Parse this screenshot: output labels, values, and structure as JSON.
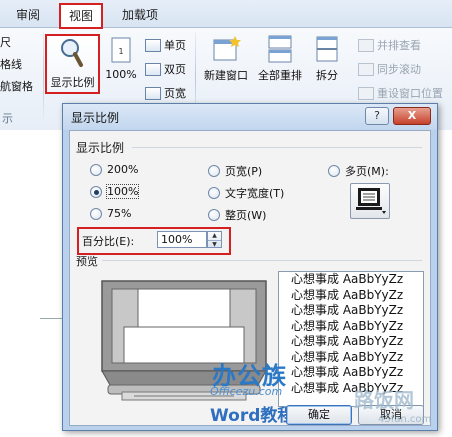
{
  "ribbon": {
    "tabs": [
      "审阅",
      "视图",
      "加载项"
    ],
    "active_tab": "视图",
    "left_cut": [
      "尺",
      "格线",
      "航窗格"
    ],
    "left_group_label": "示",
    "zoom_button": "显示比例",
    "hundred_button": "100%",
    "page_buttons": [
      "单页",
      "双页",
      "页宽"
    ],
    "window_buttons": [
      "新建窗口",
      "全部重排",
      "拆分"
    ],
    "right_buttons": [
      "并排查看",
      "同步滚动",
      "重设窗口位置"
    ]
  },
  "dialog": {
    "title": "显示比例",
    "help": "?",
    "close": "X",
    "zoom_section": "显示比例",
    "radios": {
      "z200": "200%",
      "z100": "100%",
      "z75": "75%",
      "page_width": "页宽(P)",
      "text_width": "文字宽度(T)",
      "whole_page": "整页(W)",
      "many_pages": "多页(M):"
    },
    "selected": "100%",
    "percent_label": "百分比(E):",
    "percent_value": "100%",
    "preview_label": "预览",
    "sample_lines": [
      "心想事成 AaBbYyZz",
      "心想事成 AaBbYyZz",
      "心想事成 AaBbYyZz",
      "心想事成 AaBbYyZz",
      "心想事成 AaBbYyZz",
      "心想事成 AaBbYyZz",
      "心想事成 AaBbYyZz",
      "心想事成 AaBbYyZz"
    ],
    "ok": "确定",
    "cancel": "取消"
  },
  "watermark": {
    "brand": "办公族",
    "url": "Officezu.com",
    "sub": "Word教程",
    "site_mark": "路饭网",
    "site_url": "45fan.com"
  },
  "colors": {
    "highlight": "#d42020",
    "dialog_frame": "#b9d1ec",
    "accent": "#2b78c6"
  }
}
